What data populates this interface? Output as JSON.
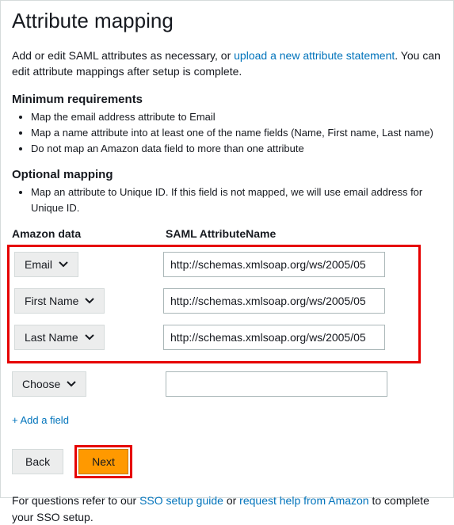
{
  "title": "Attribute mapping",
  "intro": {
    "prefix": "Add or edit SAML attributes as necessary, or ",
    "link": "upload a new attribute statement",
    "suffix": ". You can edit attribute mappings after setup is complete."
  },
  "minReq": {
    "heading": "Minimum requirements",
    "items": [
      "Map the email address attribute to Email",
      "Map a name attribute into at least one of the name fields (Name, First name, Last name)",
      "Do not map an Amazon data field to more than one attribute"
    ]
  },
  "optional": {
    "heading": "Optional mapping",
    "items": [
      "Map an attribute to Unique ID. If this field is not mapped, we will use email address for Unique ID."
    ]
  },
  "columns": {
    "left": "Amazon data",
    "right": "SAML AttributeName"
  },
  "rows": [
    {
      "label": "Email",
      "value": "http://schemas.xmlsoap.org/ws/2005/05"
    },
    {
      "label": "First Name",
      "value": "http://schemas.xmlsoap.org/ws/2005/05"
    },
    {
      "label": "Last Name",
      "value": "http://schemas.xmlsoap.org/ws/2005/05"
    }
  ],
  "extraRow": {
    "label": "Choose",
    "value": ""
  },
  "addField": "+ Add a field",
  "buttons": {
    "back": "Back",
    "next": "Next"
  },
  "footer": {
    "prefix": "For questions refer to our ",
    "link1": "SSO setup guide",
    "mid": " or ",
    "link2": "request help from Amazon",
    "suffix": " to complete your SSO setup."
  }
}
